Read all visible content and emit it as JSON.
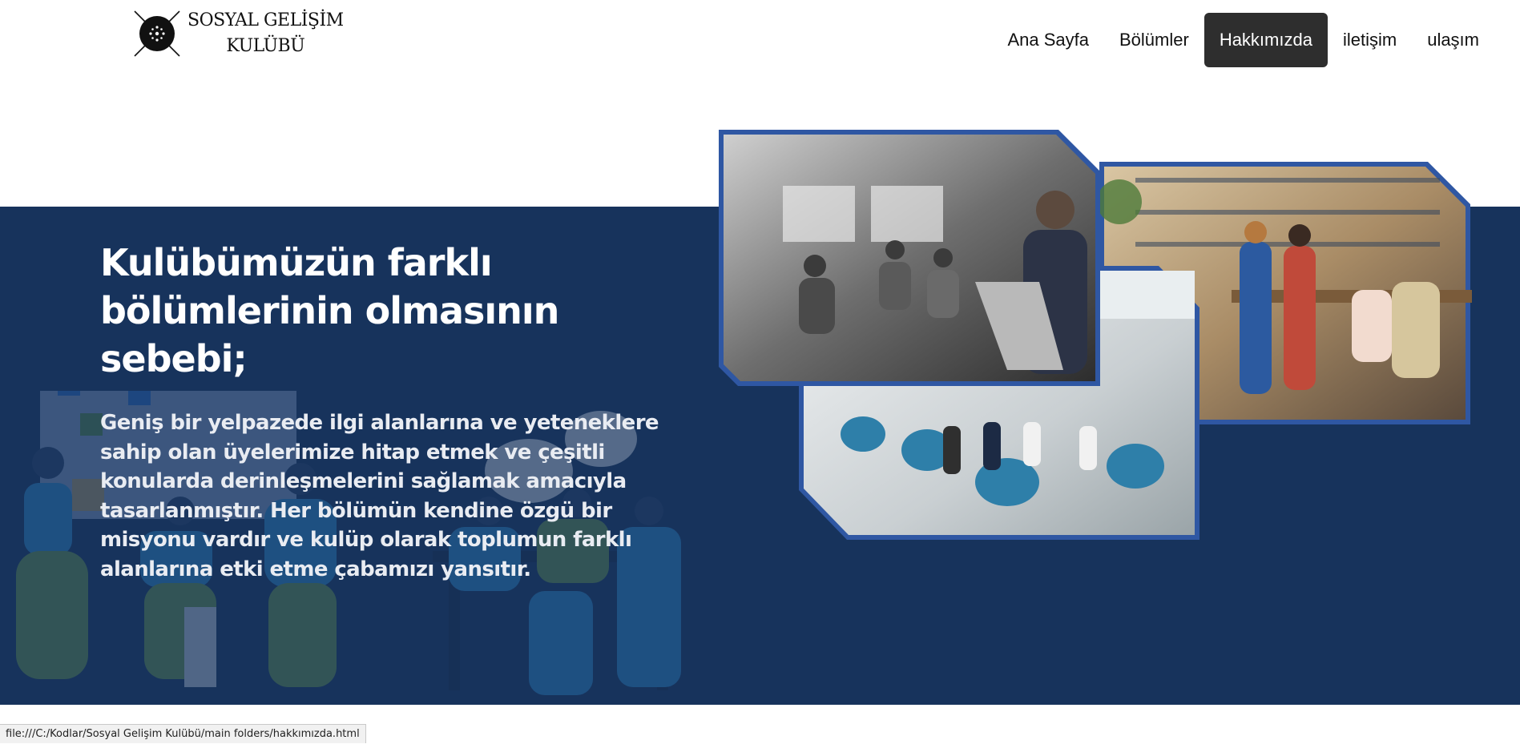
{
  "header": {
    "logo_line1": "SOSYAL GELİŞİM",
    "logo_line2": "KULÜBÜ",
    "logo_icon": "crossed-circle-emblem"
  },
  "nav": {
    "items": [
      {
        "label": "Ana Sayfa",
        "active": false
      },
      {
        "label": "Bölümler",
        "active": false
      },
      {
        "label": "Hakkımızda",
        "active": true
      },
      {
        "label": "iletişim",
        "active": false
      },
      {
        "label": "ulaşım",
        "active": false
      }
    ]
  },
  "hero": {
    "title": "Kulübümüzün farklı bölümlerinin olmasının sebebi;",
    "text": "Geniş bir yelpazede ilgi alanlarına ve yeteneklere sahip olan üyelerimize hitap etmek ve çeşitli konularda derinleşmelerini sağlamak amacıyla tasarlanmıştır. Her bölümün kendine özgü bir misyonu vardır ve kulüp olarak toplumun farklı alanlarına etki etme çabamızı yansıtır.",
    "photos": [
      "team-meeting-photo",
      "office-group-photo",
      "lounge-meeting-photo"
    ]
  },
  "statusbar": {
    "url": "file:///C:/Kodlar/Sosyal Gelişim Kulübü/main folders/hakkımızda.html"
  },
  "colors": {
    "hero_bg": "#17335c",
    "frame_border": "#2f57a3",
    "nav_active_bg": "#2e2e2e"
  }
}
